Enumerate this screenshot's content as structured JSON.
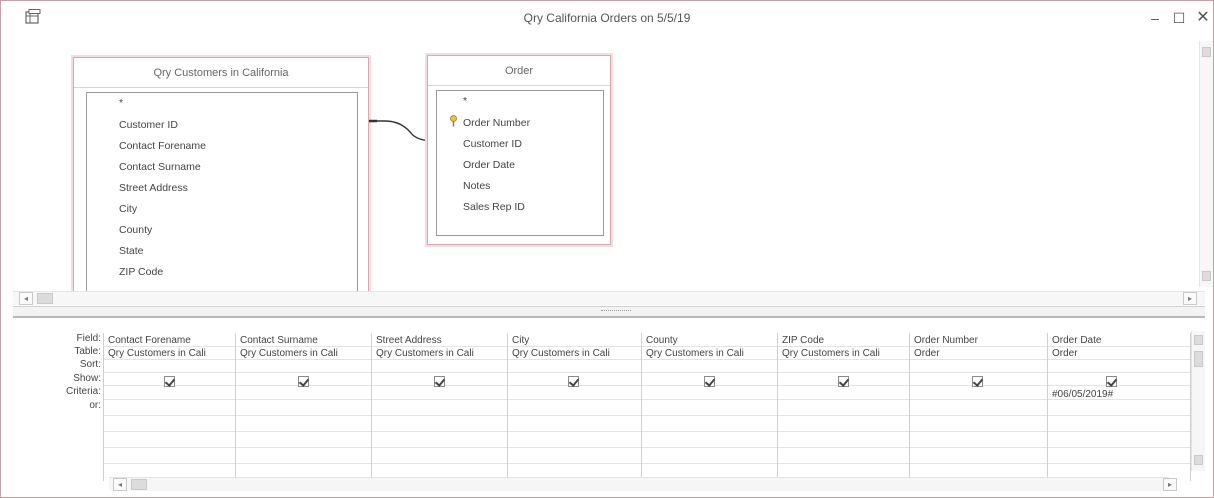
{
  "window": {
    "title": "Qry California Orders on 5/5/19",
    "icon": "query-datasheet-icon",
    "controls": {
      "minimize": "–",
      "maximize": "☐",
      "close": "✕"
    }
  },
  "tables": [
    {
      "name": "Qry Customers in California",
      "fields": [
        "*",
        "Customer ID",
        "Contact Forename",
        "Contact Surname",
        "Street Address",
        "City",
        "County",
        "State",
        "ZIP Code"
      ]
    },
    {
      "name": "Order",
      "fields": [
        "*",
        "Order Number",
        "Customer ID",
        "Order Date",
        "Notes",
        "Sales Rep ID"
      ],
      "primary_key": "Order Number"
    }
  ],
  "grid": {
    "row_labels": [
      "Field:",
      "Table:",
      "Sort:",
      "Show:",
      "Criteria:",
      "or:"
    ],
    "columns": [
      {
        "field": "Contact Forename",
        "table": "Qry Customers in Cali",
        "show": true,
        "criteria": ""
      },
      {
        "field": "Contact Surname",
        "table": "Qry Customers in Cali",
        "show": true,
        "criteria": ""
      },
      {
        "field": "Street Address",
        "table": "Qry Customers in Cali",
        "show": true,
        "criteria": ""
      },
      {
        "field": "City",
        "table": "Qry Customers in Cali",
        "show": true,
        "criteria": ""
      },
      {
        "field": "County",
        "table": "Qry Customers in Cali",
        "show": true,
        "criteria": ""
      },
      {
        "field": "ZIP Code",
        "table": "Qry Customers in Cali",
        "show": true,
        "criteria": ""
      },
      {
        "field": "Order Number",
        "table": "Order",
        "show": true,
        "criteria": ""
      },
      {
        "field": "Order Date",
        "table": "Order",
        "show": true,
        "criteria": "#06/05/2019#"
      }
    ]
  },
  "colors": {
    "border": "#c8a0a8",
    "grid_line": "#e3e3e3",
    "text": "#444444"
  }
}
